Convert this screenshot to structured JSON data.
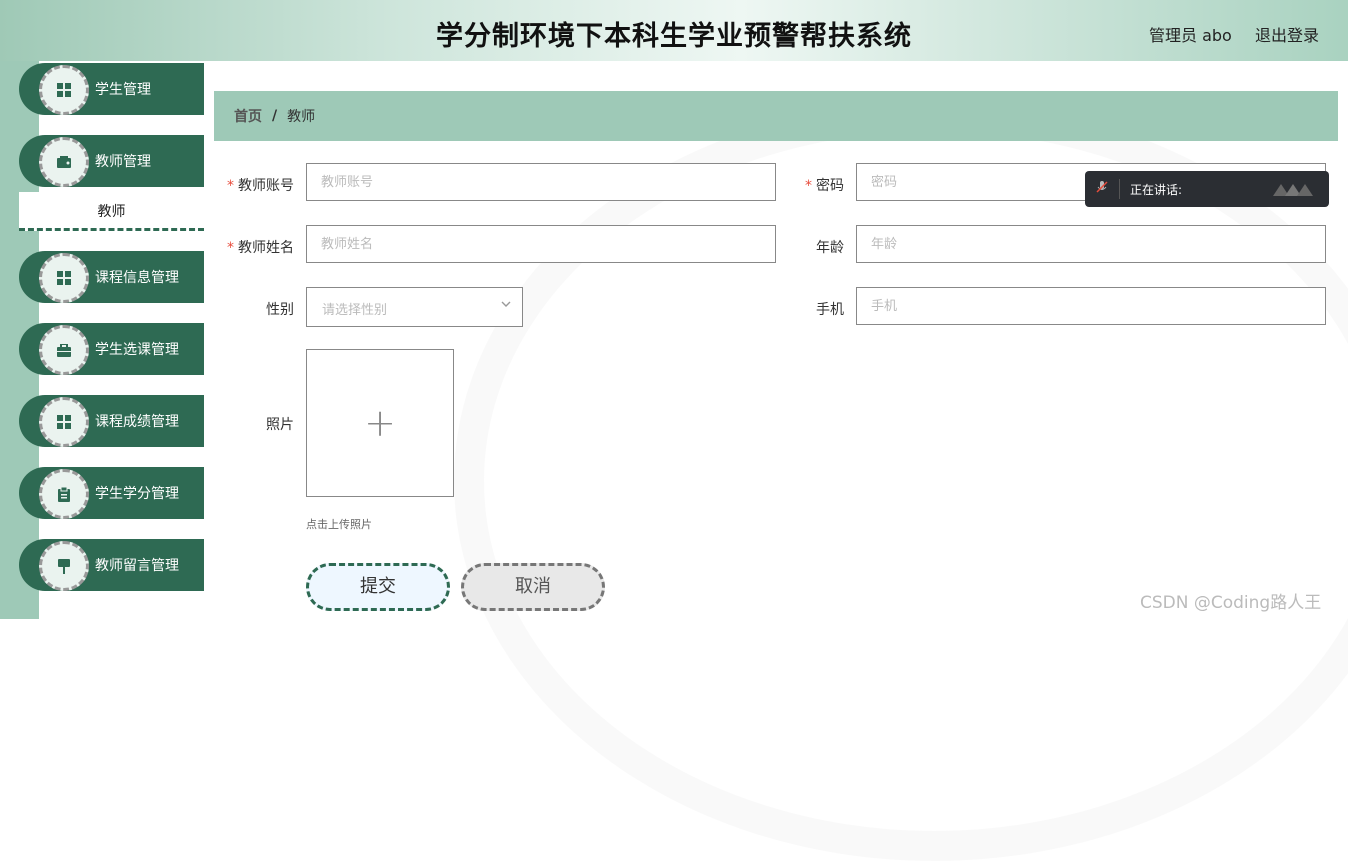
{
  "header": {
    "title": "学分制环境下本科生学业预警帮扶系统",
    "user": "管理员 abo",
    "logout": "退出登录"
  },
  "sidebar": {
    "items": [
      {
        "label": "学生管理",
        "icon": "grid-icon"
      },
      {
        "label": "教师管理",
        "icon": "wallet-icon"
      },
      {
        "label": "课程信息管理",
        "icon": "grid-icon"
      },
      {
        "label": "学生选课管理",
        "icon": "briefcase-icon"
      },
      {
        "label": "课程成绩管理",
        "icon": "grid-icon"
      },
      {
        "label": "学生学分管理",
        "icon": "clipboard-icon"
      },
      {
        "label": "教师留言管理",
        "icon": "pin-icon"
      }
    ],
    "subitem": "教师"
  },
  "breadcrumb": {
    "home": "首页",
    "sep": "/",
    "current": "教师"
  },
  "form": {
    "account_label": "教师账号",
    "account_placeholder": "教师账号",
    "password_label": "密码",
    "password_placeholder": "密码",
    "name_label": "教师姓名",
    "name_placeholder": "教师姓名",
    "age_label": "年龄",
    "age_placeholder": "年龄",
    "gender_label": "性别",
    "gender_placeholder": "请选择性别",
    "phone_label": "手机",
    "phone_placeholder": "手机",
    "photo_label": "照片",
    "upload_tip": "点击上传照片",
    "required_mark": "*",
    "plus": "+",
    "submit": "提交",
    "cancel": "取消"
  },
  "speaking": {
    "text": "正在讲话:"
  },
  "watermark": "CSDN @Coding路人王",
  "colors": {
    "primary": "#2e6a53",
    "accent": "#9ec9b7",
    "required": "#e74c3c"
  }
}
